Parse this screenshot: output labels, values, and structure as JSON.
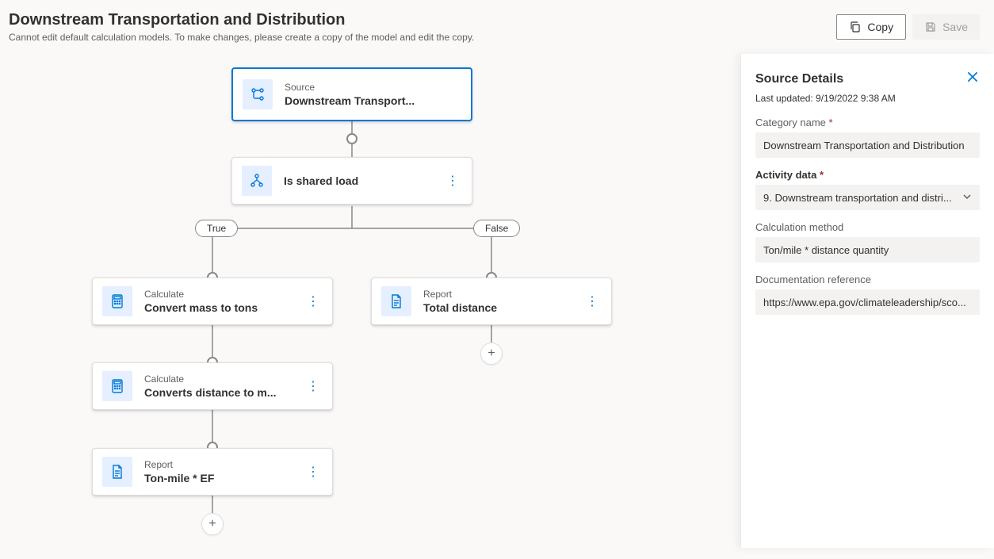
{
  "header": {
    "title": "Downstream Transportation and Distribution",
    "subtitle": "Cannot edit default calculation models. To make changes, please create a copy of the model and edit the copy.",
    "copy_label": "Copy",
    "save_label": "Save"
  },
  "nodes": {
    "source": {
      "type": "Source",
      "title": "Downstream Transport..."
    },
    "condition": {
      "title": "Is shared load"
    },
    "calc1": {
      "type": "Calculate",
      "title": "Convert mass to tons"
    },
    "calc2": {
      "type": "Calculate",
      "title": "Converts distance to m..."
    },
    "report1": {
      "type": "Report",
      "title": "Ton-mile * EF"
    },
    "report2": {
      "type": "Report",
      "title": "Total distance"
    }
  },
  "branches": {
    "true_label": "True",
    "false_label": "False"
  },
  "panel": {
    "title": "Source Details",
    "last_updated": "Last updated: 9/19/2022 9:38 AM",
    "category_label": "Category name",
    "category_value": "Downstream Transportation and Distribution",
    "activity_label": "Activity data",
    "activity_value": "9. Downstream transportation and distri...",
    "method_label": "Calculation method",
    "method_value": "Ton/mile * distance quantity",
    "doc_label": "Documentation reference",
    "doc_value": "https://www.epa.gov/climateleadership/sco..."
  }
}
